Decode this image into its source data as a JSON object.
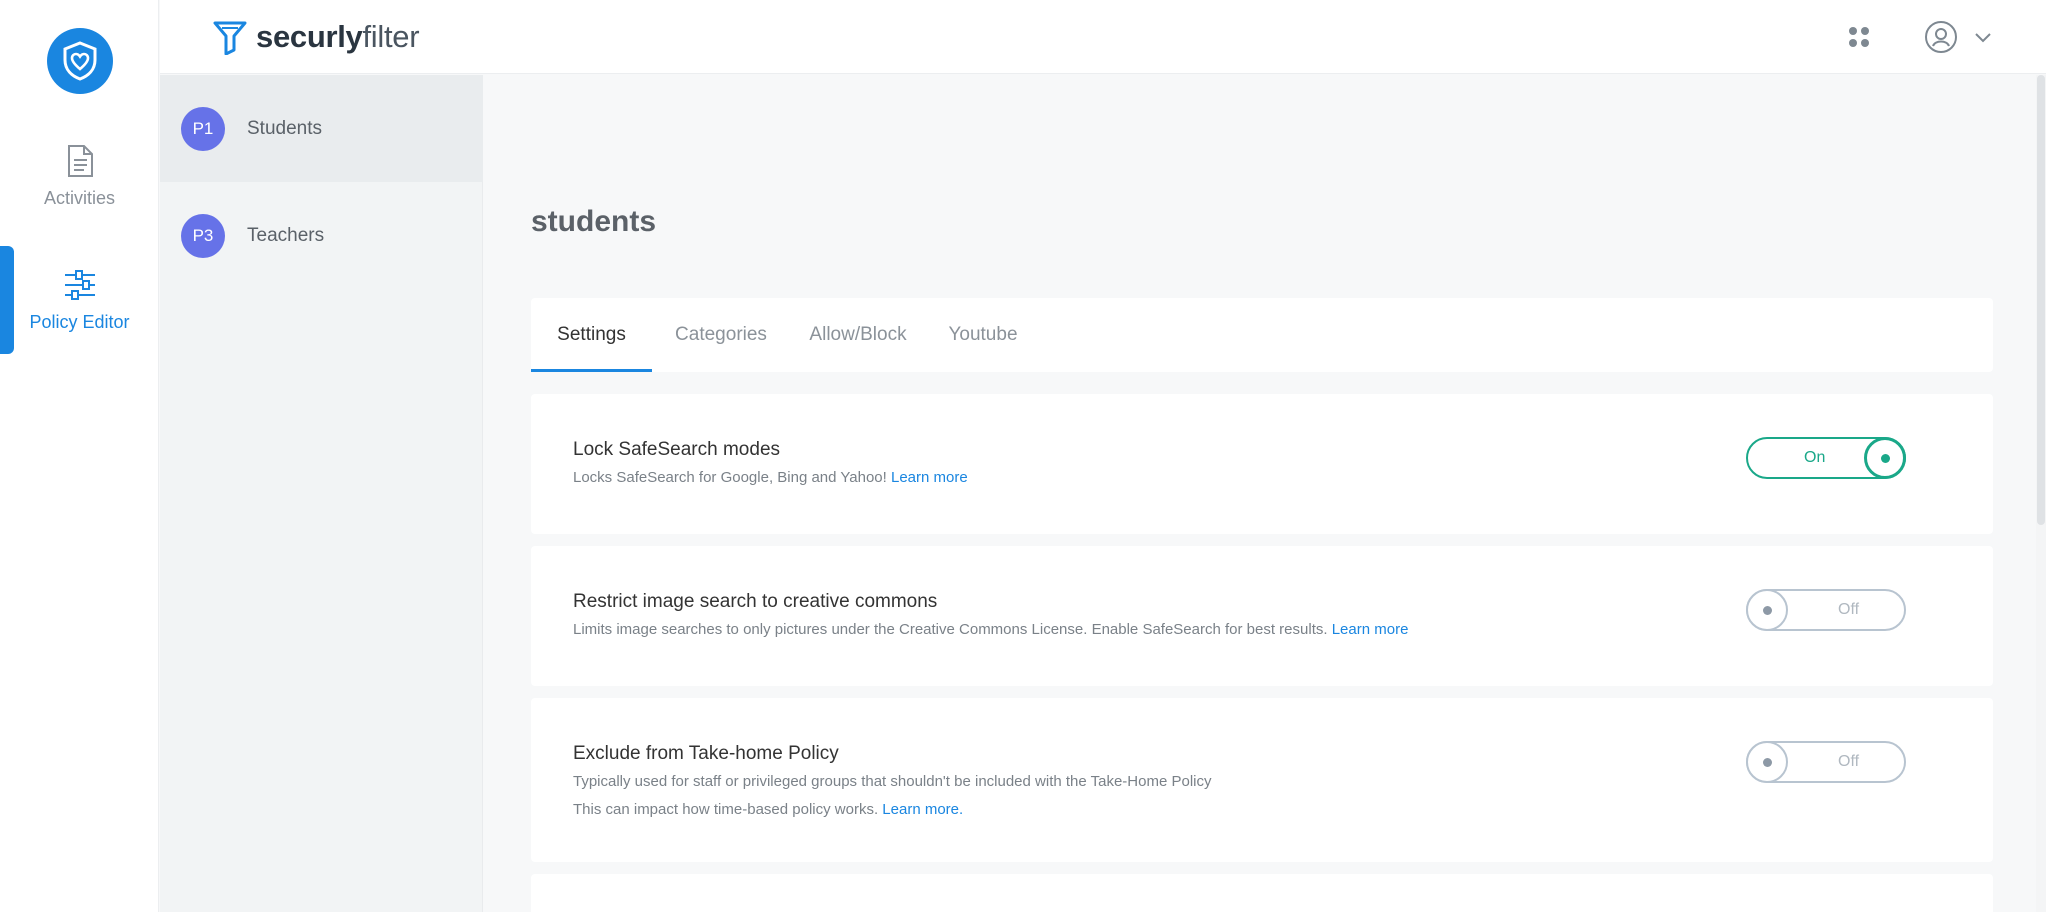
{
  "rail": {
    "items": [
      {
        "label": "Activities",
        "icon": "document-icon"
      },
      {
        "label": "Policy Editor",
        "icon": "sliders-icon"
      }
    ]
  },
  "header": {
    "brand_bold": "securly",
    "brand_light": "filter"
  },
  "groups": [
    {
      "badge": "P1",
      "name": "Students"
    },
    {
      "badge": "P3",
      "name": "Teachers"
    }
  ],
  "main": {
    "title": "students",
    "tabs": [
      "Settings",
      "Categories",
      "Allow/Block",
      "Youtube"
    ],
    "settings": [
      {
        "title": "Lock SafeSearch modes",
        "desc": "Locks SafeSearch for Google, Bing and Yahoo!",
        "link": "Learn more",
        "state": "On"
      },
      {
        "title": "Restrict image search to creative commons",
        "desc": "Limits image searches to only pictures under the Creative Commons License. Enable SafeSearch for best results.",
        "link": "Learn more",
        "state": "Off"
      },
      {
        "title": "Exclude from Take-home Policy",
        "desc": "Typically used for staff or privileged groups that shouldn't be included with the Take-Home Policy",
        "desc2": "This can impact how time-based policy works.",
        "link": "Learn more.",
        "state": "Off"
      }
    ]
  },
  "colors": {
    "accent": "#1a86e0",
    "toggle_on": "#1aa889",
    "avatar": "#6672e8"
  }
}
